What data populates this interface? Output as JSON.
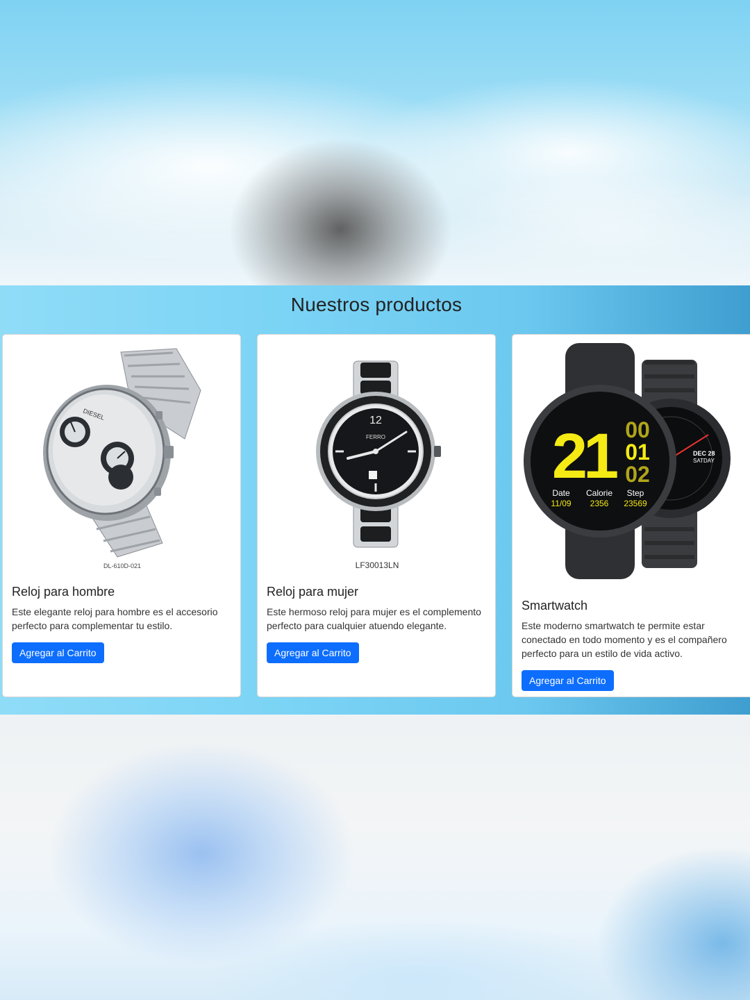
{
  "section": {
    "title": "Nuestros productos"
  },
  "products": [
    {
      "name": "Reloj para hombre",
      "description": "Este elegante reloj para hombre es el accesorio perfecto para complementar tu estilo.",
      "button": "Agregar al Carrito",
      "image_caption": "DL-610D-021",
      "image_brand": "DIESEL"
    },
    {
      "name": "Reloj para mujer",
      "description": "Este hermoso reloj para mujer es el complemento perfecto para cualquier atuendo elegante.",
      "button": "Agregar al Carrito",
      "image_caption": "LF30013LN",
      "image_brand": "FERRO"
    },
    {
      "name": "Smartwatch",
      "description": "Este moderno smartwatch te permite estar conectado en todo momento y es el compañero perfecto para un estilo de vida activo.",
      "button": "Agregar al Carrito",
      "image_screen": {
        "big": "21",
        "h1": "00",
        "h2": "01",
        "h3": "02",
        "l1": "Date",
        "v1": "11/09",
        "l2": "Calorie",
        "v2": "2356",
        "l3": "Step",
        "v3": "23569",
        "date": "DEC 28",
        "day": "SATDAY"
      }
    }
  ],
  "colors": {
    "button": "#0d6efd",
    "screen_yellow": "#f5ea14"
  }
}
